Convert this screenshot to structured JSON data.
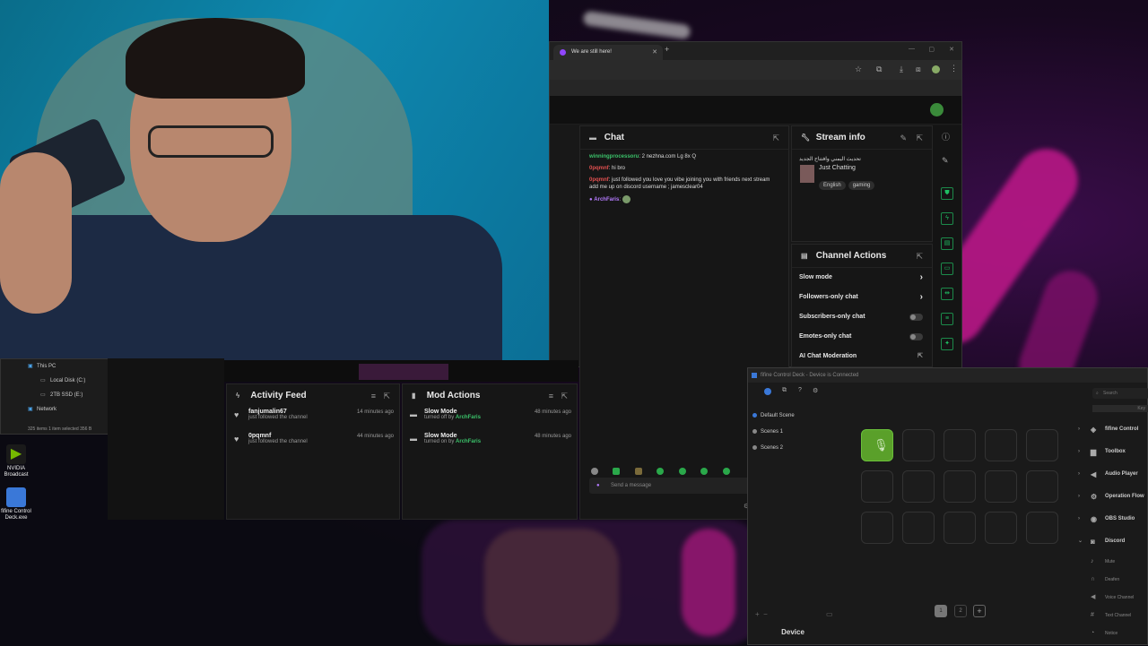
{
  "explorer": {
    "items": [
      "This PC",
      "Local Disk (C:)",
      "2TB SSD (E:)",
      "Network"
    ],
    "status": "325 items   1 item selected  356 B"
  },
  "desktop": {
    "icons": [
      "NVIDIA Broadcast",
      "fifine Control Deck.exe"
    ]
  },
  "browser": {
    "tab_title": "We are still here!"
  },
  "chat": {
    "title": "Chat",
    "messages": [
      {
        "user": "winningprocessoru",
        "text": ": 2 nezhna.com Lg 8x Q"
      },
      {
        "user": "0pqmnf",
        "text": ": hi bro"
      },
      {
        "user": "0pqmnf",
        "text": ": just followed you love you vibe joining you with friends next stream add me up on discord username ; jamesclear04"
      },
      {
        "user": "ArchFaris",
        "text": ":"
      }
    ],
    "input_placeholder": "Send a message"
  },
  "stream_info": {
    "title": "Stream info",
    "stream_title": "تحديث اليمني وافتتاح الجديد",
    "category": "Just Chatting",
    "tags": [
      "English",
      "gaming"
    ]
  },
  "channel_actions": {
    "title": "Channel Actions",
    "items": [
      "Slow mode",
      "Followers-only chat",
      "Subscribers-only chat",
      "Emotes-only chat",
      "AI Chat Moderation"
    ]
  },
  "activity_feed": {
    "title": "Activity Feed",
    "items": [
      {
        "user": "fanjumalin67",
        "action": "just followed the channel",
        "time": "14 minutes ago"
      },
      {
        "user": "0pqmnf",
        "action": "just followed the channel",
        "time": "44 minutes ago"
      }
    ]
  },
  "mod_actions": {
    "title": "Mod Actions",
    "items": [
      {
        "action": "Slow Mode",
        "detail": "turned off by",
        "by": "ArchFaris",
        "time": "48 minutes ago"
      },
      {
        "action": "Slow Mode",
        "detail": "turned on by",
        "by": "ArchFaris",
        "time": "48 minutes ago"
      }
    ]
  },
  "deck": {
    "title": "fifine Control Deck - Device is Connected",
    "scenes": [
      "Default Scene",
      "Scenes 1",
      "Scenes 2"
    ],
    "device_label": "Device",
    "pages": [
      "1",
      "2"
    ],
    "search_placeholder": "Search",
    "key_label": "Key",
    "plugins": [
      "fifine Control",
      "Toolbox",
      "Audio Player",
      "Operation Flow",
      "OBS Studio",
      "Discord"
    ],
    "discord_actions": [
      "Mute",
      "Deafen",
      "Voice Channel",
      "Text Channel",
      "Notice"
    ]
  }
}
